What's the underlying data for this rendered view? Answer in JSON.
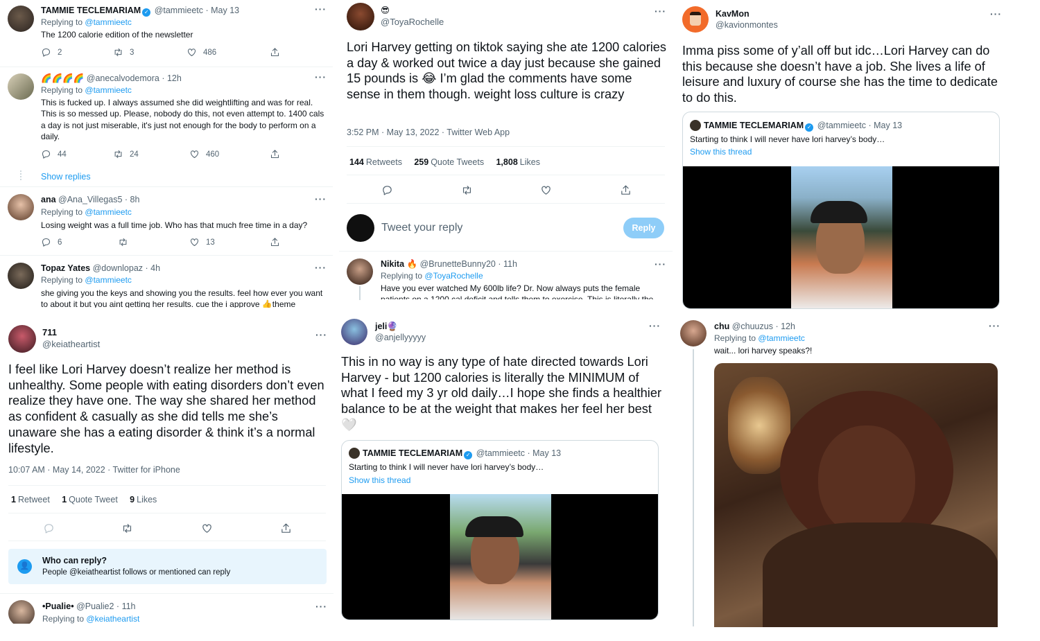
{
  "col1": {
    "t1": {
      "name": "TAMMIE TECLEMARIAM",
      "handle": "@tammieetc",
      "time": "May 13",
      "replying": "Replying to",
      "reply_to": "@tammieetc",
      "text": "The 1200 calorie edition of the newsletter",
      "replies": "2",
      "retweets": "3",
      "likes": "486"
    },
    "t2": {
      "name": "🌈🌈🌈🌈",
      "handle": "@anecalvodemora",
      "time": "12h",
      "replying": "Replying to",
      "reply_to": "@tammieetc",
      "text": "This is fucked up. I always assumed she did weightlifting and was for real. This is so messed up. Please, nobody do this, not even attempt to. 1400 cals a day is not just miserable, it's just not enough for the body to perform on a daily.",
      "replies": "44",
      "retweets": "24",
      "likes": "460",
      "show_replies": "Show replies"
    },
    "t3": {
      "name": "ana",
      "handle": "@Ana_Villegas5",
      "time": "8h",
      "replying": "Replying to",
      "reply_to": "@tammieetc",
      "text": "Losing weight was a full time job.  Who has that much free time in a day?",
      "replies": "6",
      "retweets": "",
      "likes": "13"
    },
    "t4": {
      "name": "Topaz Yates",
      "handle": "@downlopaz",
      "time": "4h",
      "replying": "Replying to",
      "reply_to": "@tammieetc",
      "text": "she giving you the keys and showing you the results. feel how ever you want to about it but you aint getting her results. cue the i approve 👍theme"
    }
  },
  "col1b": {
    "name": "711",
    "handle": "@keiatheartist",
    "text": "I feel like Lori Harvey doesn’t realize her method is unhealthy. Some people with eating disorders don’t even realize they have one. The way she shared her method as confident & casually as she did tells me she’s unaware she has a eating disorder & think it’s a normal lifestyle.",
    "meta": "10:07 AM · May 14, 2022 · Twitter for iPhone",
    "rt_n": "1",
    "rt_l": "Retweet",
    "qt_n": "1",
    "qt_l": "Quote Tweet",
    "lk_n": "9",
    "lk_l": "Likes",
    "who_title": "Who can reply?",
    "who_text": "People @keiatheartist follows or mentioned can reply",
    "r_name": "•Pualie•",
    "r_handle": "@Pualie2",
    "r_time": "11h",
    "r_replying": "Replying to",
    "r_reply_to": "@keiatheartist"
  },
  "col2": {
    "name": "😎",
    "handle": "@ToyaRochelle",
    "text": "Lori Harvey getting on tiktok saying she ate 1200 calories a day & worked out twice a day just because she gained 15 pounds is 😂 I’m glad the comments have some sense in them though. weight loss culture is crazy",
    "meta": "3:52 PM · May 13, 2022 · Twitter Web App",
    "rt_n": "144",
    "rt_l": "Retweets",
    "qt_n": "259",
    "qt_l": "Quote Tweets",
    "lk_n": "1,808",
    "lk_l": "Likes",
    "reply_placeholder": "Tweet your reply",
    "reply_btn": "Reply",
    "r_name": "Nikita 🔥",
    "r_handle": "@BrunetteBunny20",
    "r_time": "11h",
    "r_replying": "Replying to",
    "r_reply_to": "@ToyaRochelle",
    "r_text": "Have you ever watched My 600lb life? Dr. Now always puts the female patients on a 1200 cal deficit and tells them to exercise. This is literally the"
  },
  "col2b": {
    "name": "jeli🔮",
    "handle": "@anjellyyyyy",
    "text": "This in no way is any type of hate directed towards Lori Harvey - but 1200 calories is literally the MINIMUM of what I feed my 3 yr old daily…I hope she finds a healthier balance to be at the weight that makes her feel her best 🤍",
    "q_name": "TAMMIE TECLEMARIAM",
    "q_handle": "@tammieetc",
    "q_time": "May 13",
    "q_text": "Starting to think I will never have lori harvey’s body…",
    "q_show": "Show this thread"
  },
  "col3": {
    "name": "KavMon",
    "handle": "@kavionmontes",
    "text": "Imma piss some of y’all off but idc…Lori Harvey can do this because she doesn’t have a job. She lives a life of leisure and luxury of course she has the time to dedicate to do this.",
    "q_name": "TAMMIE TECLEMARIAM",
    "q_handle": "@tammieetc",
    "q_time": "May 13",
    "q_text": "Starting to think I will never have lori harvey’s body…",
    "q_show": "Show this thread"
  },
  "col3b": {
    "name": "chu",
    "handle": "@chuuzus",
    "time": "12h",
    "replying": "Replying to",
    "reply_to": "@tammieetc",
    "text": "wait... lori harvey speaks?!"
  },
  "icons": [
    "reply-icon",
    "retweet-icon",
    "like-icon",
    "share-icon",
    "more-icon",
    "verified-icon",
    "lock-icon"
  ],
  "colors": {
    "accent": "#1d9bf0",
    "text": "#0f1419",
    "muted": "#536471",
    "border": "#cfd9de"
  }
}
